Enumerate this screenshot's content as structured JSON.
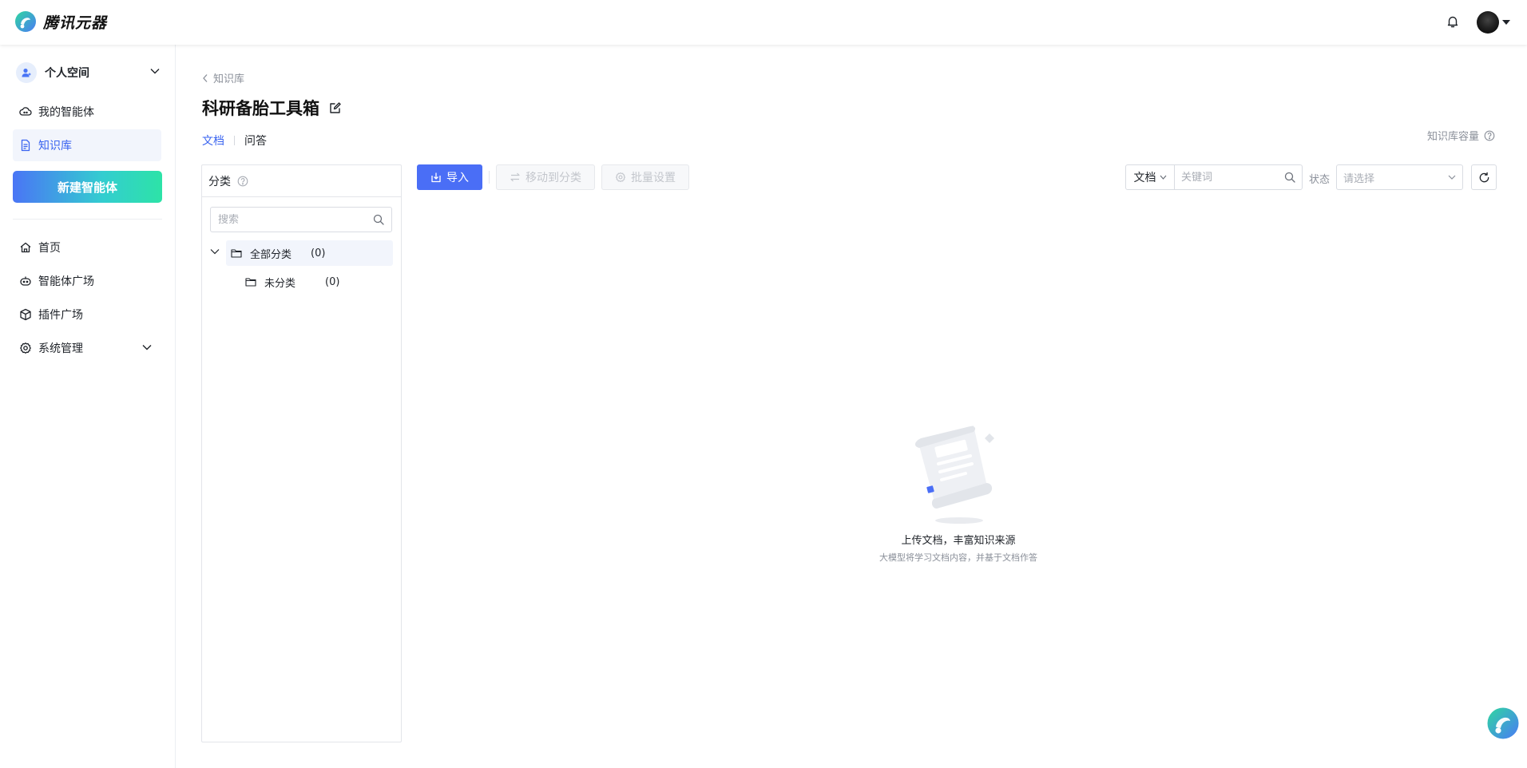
{
  "header": {
    "brand": "腾讯元器",
    "icons": {
      "logo": "tencent-yuanqi-logo",
      "bell": "bell-icon",
      "avatar": "avatar",
      "caret": "caret-down-icon"
    }
  },
  "sidebar": {
    "space_label": "个人空间",
    "items_top": [
      {
        "label": "我的智能体",
        "icon": "robot-cloud-icon"
      },
      {
        "label": "知识库",
        "icon": "document-icon",
        "active": true
      }
    ],
    "new_agent_label": "新建智能体",
    "items_bottom": [
      {
        "label": "首页",
        "icon": "home-icon"
      },
      {
        "label": "智能体广场",
        "icon": "robot-icon"
      },
      {
        "label": "插件广场",
        "icon": "cube-icon"
      },
      {
        "label": "系统管理",
        "icon": "gear-icon"
      }
    ]
  },
  "main": {
    "breadcrumb": "知识库",
    "title": "科研备胎工具箱",
    "tabs": [
      {
        "label": "文档",
        "active": true
      },
      {
        "label": "问答",
        "active": false
      }
    ],
    "capacity_label": "知识库容量"
  },
  "category": {
    "header": "分类",
    "search_placeholder": "搜索",
    "tree": [
      {
        "label": "全部分类",
        "count": "(0)"
      },
      {
        "label": "未分类",
        "count": "(0)"
      }
    ]
  },
  "toolbar": {
    "import_label": "导入",
    "move_label": "移动到分类",
    "batch_label": "批量设置",
    "filter_type": "文档",
    "keyword_placeholder": "关键词",
    "status_label": "状态",
    "status_placeholder": "请选择"
  },
  "empty_state": {
    "title": "上传文档，丰富知识来源",
    "subtitle": "大模型将学习文档内容，并基于文档作答"
  },
  "colors": {
    "accent": "#3a64f0",
    "button": "#4a6ef6",
    "gradient_start": "#4a75f5",
    "gradient_end": "#2de3a7"
  }
}
